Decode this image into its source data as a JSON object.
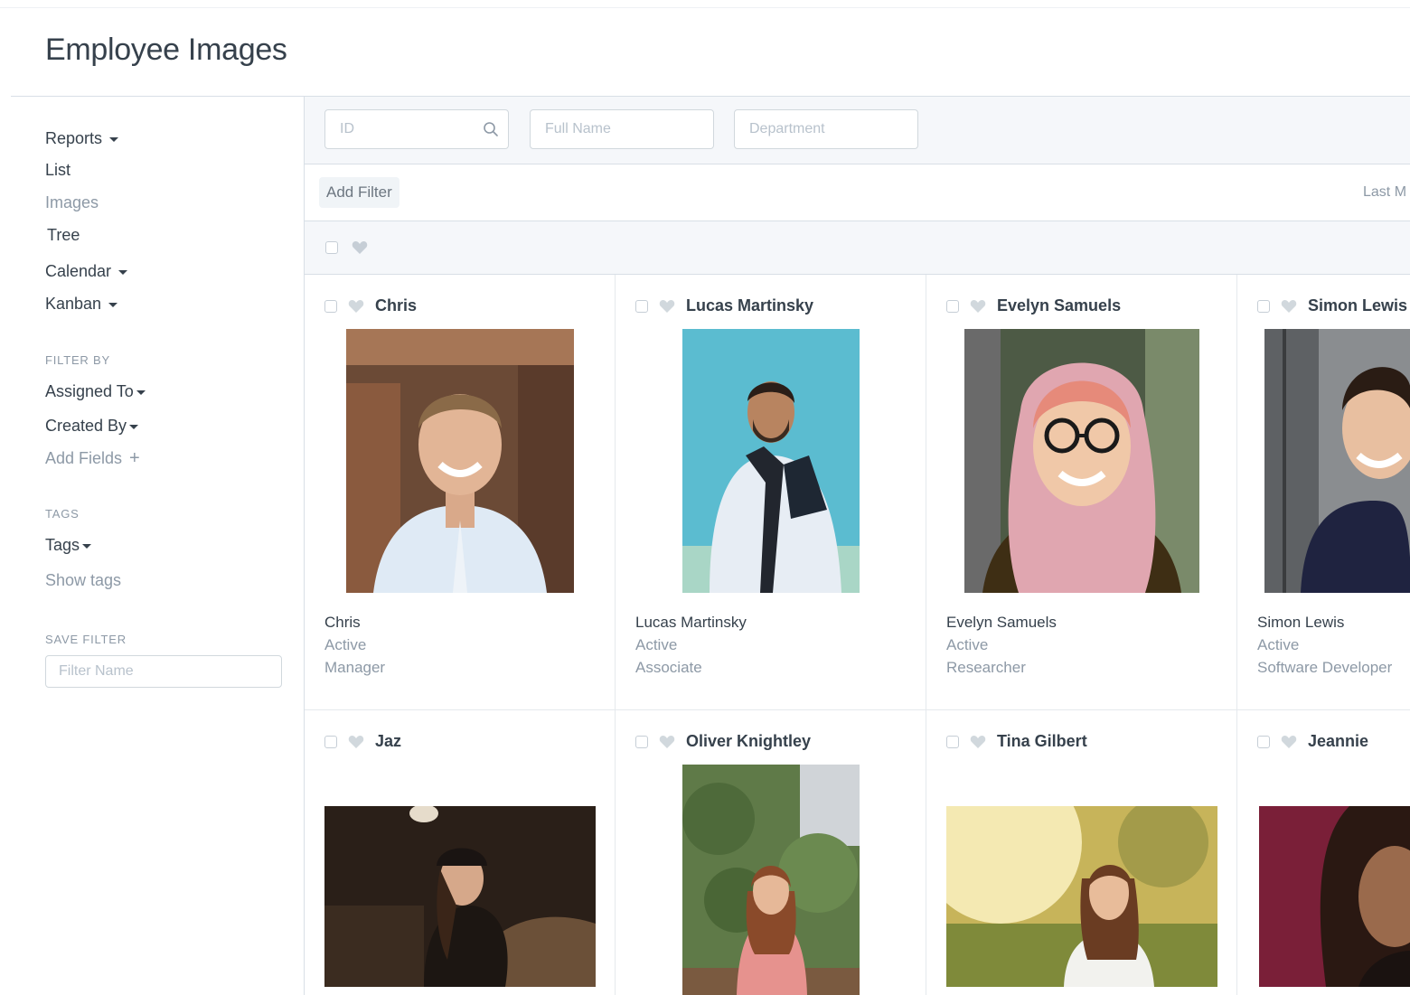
{
  "page": {
    "title": "Employee Images"
  },
  "sidebar": {
    "views": [
      {
        "label": "Reports",
        "dropdown": true
      },
      {
        "label": "List",
        "dropdown": false
      },
      {
        "label": "Images",
        "dropdown": false,
        "active": true
      },
      {
        "label": "Tree",
        "dropdown": false
      },
      {
        "label": "Calendar",
        "dropdown": true
      },
      {
        "label": "Kanban",
        "dropdown": true
      }
    ],
    "filter_by_heading": "FILTER BY",
    "filter_by": [
      {
        "label": "Assigned To"
      },
      {
        "label": "Created By"
      }
    ],
    "add_fields": "Add Fields",
    "tags_heading": "TAGS",
    "tags_label": "Tags",
    "show_tags": "Show tags",
    "save_filter_heading": "SAVE FILTER",
    "filter_name_placeholder": "Filter Name"
  },
  "filters": {
    "id_placeholder": "ID",
    "full_name_placeholder": "Full Name",
    "department_placeholder": "Department",
    "add_filter": "Add Filter",
    "sort_label": "Last M"
  },
  "employees": [
    {
      "name": "Chris",
      "status": "Active",
      "designation": "Manager",
      "photo": "smiling-man-white-shirt"
    },
    {
      "name": "Lucas Martinsky",
      "status": "Active",
      "designation": "Associate",
      "photo": "man-scarf-teal-background"
    },
    {
      "name": "Evelyn Samuels",
      "status": "Active",
      "designation": "Researcher",
      "photo": "woman-glasses-pink-hair"
    },
    {
      "name": "Simon Lewis",
      "status": "Active",
      "designation": "Software Developer",
      "photo": "man-dark-shirt-grey-wall"
    },
    {
      "name": "Jaz",
      "photo": "woman-hat-couch"
    },
    {
      "name": "Oliver Knightley",
      "photo": "woman-pink-top-garden"
    },
    {
      "name": "Tina Gilbert",
      "photo": "woman-sunlit-field"
    },
    {
      "name": "Jeannie",
      "photo": "woman-maroon-background"
    }
  ],
  "colors": {
    "text": "#36414c",
    "muted": "#8d99a6",
    "border": "#d8dfe6",
    "panel_bg": "#f5f7fa"
  }
}
